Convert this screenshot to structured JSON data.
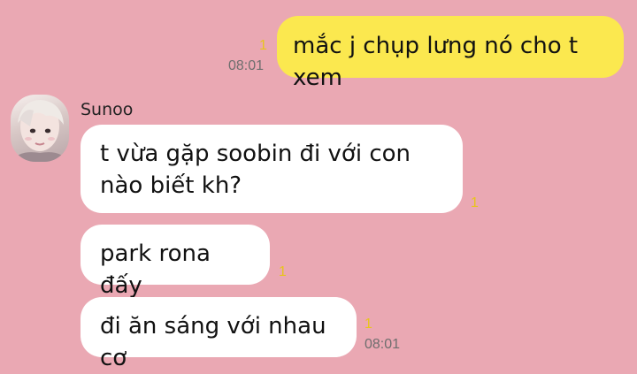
{
  "colors": {
    "background": "#eaa8b3",
    "outgoing_bubble": "#fbe84f",
    "incoming_bubble": "#ffffff",
    "unread_marker": "#e8c41d",
    "timestamp": "#6e6e6e"
  },
  "chat": {
    "outgoing": [
      {
        "text": "mắc j chụp lưng nó cho t xem",
        "unread": "1",
        "time": "08:01"
      }
    ],
    "sender": {
      "name": "Sunoo",
      "avatar": "avatar-photo"
    },
    "incoming": [
      {
        "text": "t vừa gặp soobin đi với con nào biết kh?",
        "unread": "1"
      },
      {
        "text": "park rona đấy",
        "unread": "1"
      },
      {
        "text": "đi ăn sáng với nhau cơ",
        "unread": "1",
        "time": "08:01"
      }
    ]
  }
}
